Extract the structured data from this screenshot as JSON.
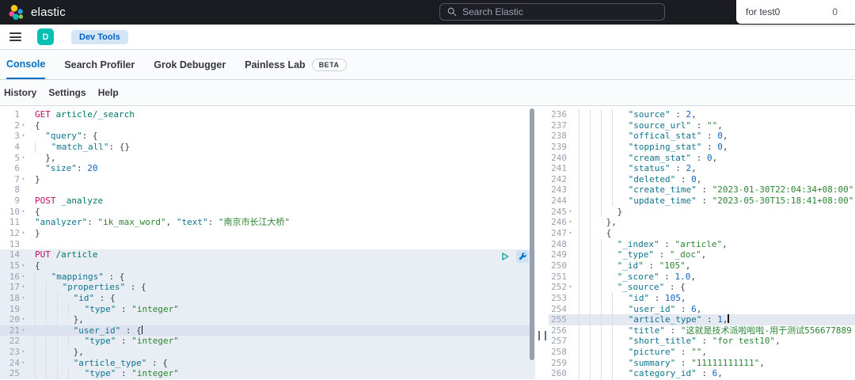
{
  "topbar": {
    "brand": "elastic",
    "search_placeholder": "Search Elastic",
    "popup": {
      "text": "for test0",
      "count": "0"
    }
  },
  "nav": {
    "avatar": "D",
    "breadcrumb": "Dev Tools"
  },
  "tabs": [
    {
      "label": "Console",
      "active": true
    },
    {
      "label": "Search Profiler"
    },
    {
      "label": "Grok Debugger"
    },
    {
      "label": "Painless Lab",
      "beta": "BETA"
    }
  ],
  "menu": {
    "history": "History",
    "settings": "Settings",
    "help": "Help"
  },
  "colors": {
    "topbar_bg": "#1b1c21",
    "accent_blue": "#0071c2",
    "avatar_teal": "#00bfb3",
    "badge_bg": "#d5e5f8",
    "badge_text": "#0061c5",
    "method": "#c80a68",
    "url": "#00756b",
    "key": "#0e7490",
    "string": "#2d8533",
    "number": "#0f62c4",
    "selected_block": "#e9edf4",
    "active_line": "#dce2ee"
  },
  "editor": {
    "left": {
      "lines": [
        {
          "n": 1,
          "seg": [
            [
              "m",
              "GET"
            ],
            [
              "u",
              " article/_search"
            ]
          ]
        },
        {
          "n": 2,
          "f": 1,
          "seg": [
            [
              "p",
              "{"
            ]
          ]
        },
        {
          "n": 3,
          "f": 1,
          "seg": [
            [
              "k",
              "  \"query\""
            ],
            [
              "p",
              ": {"
            ]
          ]
        },
        {
          "n": 4,
          "g": 1,
          "seg": [
            [
              "k",
              " \"match_all\""
            ],
            [
              "p",
              ": {}"
            ]
          ]
        },
        {
          "n": 5,
          "f": 1,
          "seg": [
            [
              "p",
              "  },"
            ]
          ]
        },
        {
          "n": 6,
          "seg": [
            [
              "k",
              "  \"size\""
            ],
            [
              "p",
              ": "
            ],
            [
              "d",
              "20"
            ]
          ]
        },
        {
          "n": 7,
          "f": 1,
          "seg": [
            [
              "p",
              "}"
            ]
          ]
        },
        {
          "n": 8,
          "seg": []
        },
        {
          "n": 9,
          "seg": [
            [
              "m",
              "POST"
            ],
            [
              "u",
              " _analyze"
            ]
          ]
        },
        {
          "n": 10,
          "f": 1,
          "seg": [
            [
              "p",
              "{"
            ]
          ]
        },
        {
          "n": 11,
          "seg": [
            [
              "k",
              "\"analyzer\""
            ],
            [
              "p",
              ": "
            ],
            [
              "s",
              "\"ik_max_word\""
            ],
            [
              "p",
              ", "
            ],
            [
              "k",
              "\"text\""
            ],
            [
              "p",
              ": "
            ],
            [
              "s",
              "\"南京市长江大桥\""
            ]
          ]
        },
        {
          "n": 12,
          "f": 1,
          "seg": [
            [
              "p",
              "}"
            ]
          ]
        },
        {
          "n": 13,
          "seg": []
        },
        {
          "n": 14,
          "hl": "b",
          "seg": [
            [
              "m",
              "PUT"
            ],
            [
              "u",
              " /article"
            ]
          ]
        },
        {
          "n": 15,
          "f": 1,
          "hl": "b",
          "seg": [
            [
              "p",
              "{"
            ]
          ]
        },
        {
          "n": 16,
          "f": 1,
          "hl": "b",
          "g": 1,
          "seg": [
            [
              "k",
              " \"mappings\""
            ],
            [
              "p",
              " : {"
            ]
          ]
        },
        {
          "n": 17,
          "f": 1,
          "hl": "b",
          "g": 2,
          "seg": [
            [
              "k",
              " \"properties\""
            ],
            [
              "p",
              " : {"
            ]
          ]
        },
        {
          "n": 18,
          "f": 1,
          "hl": "b",
          "g": 3,
          "seg": [
            [
              "k",
              " \"id\""
            ],
            [
              "p",
              " : {"
            ]
          ]
        },
        {
          "n": 19,
          "hl": "b",
          "g": 4,
          "seg": [
            [
              "k",
              " \"type\""
            ],
            [
              "p",
              " : "
            ],
            [
              "s",
              "\"integer\""
            ]
          ]
        },
        {
          "n": 20,
          "f": 1,
          "hl": "b",
          "g": 3,
          "seg": [
            [
              "p",
              " },"
            ]
          ]
        },
        {
          "n": 21,
          "f": 1,
          "hl": "bl",
          "g": 3,
          "seg": [
            [
              "k",
              " \"user_id\""
            ],
            [
              "p",
              " : {"
            ],
            [
              "c",
              ""
            ]
          ]
        },
        {
          "n": 22,
          "hl": "b",
          "g": 4,
          "seg": [
            [
              "k",
              " \"type\""
            ],
            [
              "p",
              " : "
            ],
            [
              "s",
              "\"integer\""
            ]
          ]
        },
        {
          "n": 23,
          "f": 1,
          "hl": "b",
          "g": 3,
          "seg": [
            [
              "p",
              " },"
            ]
          ]
        },
        {
          "n": 24,
          "f": 1,
          "hl": "b",
          "g": 3,
          "seg": [
            [
              "k",
              " \"article_type\""
            ],
            [
              "p",
              " : {"
            ]
          ]
        },
        {
          "n": 25,
          "hl": "b",
          "g": 4,
          "seg": [
            [
              "k",
              " \"type\""
            ],
            [
              "p",
              " : "
            ],
            [
              "s",
              "\"integer\""
            ]
          ]
        }
      ]
    },
    "right": {
      "lines": [
        {
          "n": 236,
          "g": 4,
          "seg": [
            [
              "k",
              " \"source\""
            ],
            [
              "p",
              " : "
            ],
            [
              "d",
              "2"
            ],
            [
              "p",
              ","
            ]
          ]
        },
        {
          "n": 237,
          "g": 4,
          "seg": [
            [
              "k",
              " \"source_url\""
            ],
            [
              "p",
              " : "
            ],
            [
              "s",
              "\"\""
            ],
            [
              "p",
              ","
            ]
          ]
        },
        {
          "n": 238,
          "g": 4,
          "seg": [
            [
              "k",
              " \"offical_stat\""
            ],
            [
              "p",
              " : "
            ],
            [
              "d",
              "0"
            ],
            [
              "p",
              ","
            ]
          ]
        },
        {
          "n": 239,
          "g": 4,
          "seg": [
            [
              "k",
              " \"topping_stat\""
            ],
            [
              "p",
              " : "
            ],
            [
              "d",
              "0"
            ],
            [
              "p",
              ","
            ]
          ]
        },
        {
          "n": 240,
          "g": 4,
          "seg": [
            [
              "k",
              " \"cream_stat\""
            ],
            [
              "p",
              " : "
            ],
            [
              "d",
              "0"
            ],
            [
              "p",
              ","
            ]
          ]
        },
        {
          "n": 241,
          "g": 4,
          "seg": [
            [
              "k",
              " \"status\""
            ],
            [
              "p",
              " : "
            ],
            [
              "d",
              "2"
            ],
            [
              "p",
              ","
            ]
          ]
        },
        {
          "n": 242,
          "g": 4,
          "seg": [
            [
              "k",
              " \"deleted\""
            ],
            [
              "p",
              " : "
            ],
            [
              "d",
              "0"
            ],
            [
              "p",
              ","
            ]
          ]
        },
        {
          "n": 243,
          "g": 4,
          "seg": [
            [
              "k",
              " \"create_time\""
            ],
            [
              "p",
              " : "
            ],
            [
              "s",
              "\"2023-01-30T22:04:34+08:00\""
            ],
            [
              "p",
              ","
            ]
          ]
        },
        {
          "n": 244,
          "g": 4,
          "seg": [
            [
              "k",
              " \"update_time\""
            ],
            [
              "p",
              " : "
            ],
            [
              "s",
              "\"2023-05-30T15:18:41+08:00\""
            ]
          ]
        },
        {
          "n": 245,
          "f": 1,
          "g": 3,
          "seg": [
            [
              "p",
              " }"
            ]
          ]
        },
        {
          "n": 246,
          "f": 1,
          "g": 2,
          "seg": [
            [
              "p",
              " },"
            ]
          ]
        },
        {
          "n": 247,
          "f": 1,
          "g": 2,
          "seg": [
            [
              "p",
              " {"
            ]
          ]
        },
        {
          "n": 248,
          "g": 3,
          "seg": [
            [
              "k",
              " \"_index\""
            ],
            [
              "p",
              " : "
            ],
            [
              "s",
              "\"article\""
            ],
            [
              "p",
              ","
            ]
          ]
        },
        {
          "n": 249,
          "g": 3,
          "seg": [
            [
              "k",
              " \"_type\""
            ],
            [
              "p",
              " : "
            ],
            [
              "s",
              "\"_doc\""
            ],
            [
              "p",
              ","
            ]
          ]
        },
        {
          "n": 250,
          "g": 3,
          "seg": [
            [
              "k",
              " \"_id\""
            ],
            [
              "p",
              " : "
            ],
            [
              "s",
              "\"105\""
            ],
            [
              "p",
              ","
            ]
          ]
        },
        {
          "n": 251,
          "g": 3,
          "seg": [
            [
              "k",
              " \"_score\""
            ],
            [
              "p",
              " : "
            ],
            [
              "d",
              "1.0"
            ],
            [
              "p",
              ","
            ]
          ]
        },
        {
          "n": 252,
          "f": 1,
          "g": 3,
          "seg": [
            [
              "k",
              " \"_source\""
            ],
            [
              "p",
              " : {"
            ]
          ]
        },
        {
          "n": 253,
          "g": 4,
          "seg": [
            [
              "k",
              " \"id\""
            ],
            [
              "p",
              " : "
            ],
            [
              "d",
              "105"
            ],
            [
              "p",
              ","
            ]
          ]
        },
        {
          "n": 254,
          "g": 4,
          "seg": [
            [
              "k",
              " \"user_id\""
            ],
            [
              "p",
              " : "
            ],
            [
              "d",
              "6"
            ],
            [
              "p",
              ","
            ]
          ]
        },
        {
          "n": 255,
          "hl": "l",
          "g": 4,
          "seg": [
            [
              "k",
              " \"article_type\""
            ],
            [
              "p",
              " : "
            ],
            [
              "d",
              "1"
            ],
            [
              "p",
              ","
            ],
            [
              "c",
              ""
            ]
          ]
        },
        {
          "n": 256,
          "g": 4,
          "seg": [
            [
              "k",
              " \"title\""
            ],
            [
              "p",
              " : "
            ],
            [
              "s",
              "\"这就是技术派啦啦啦-用于测试556677889"
            ]
          ]
        },
        {
          "n": 257,
          "g": 4,
          "seg": [
            [
              "k",
              " \"short_title\""
            ],
            [
              "p",
              " : "
            ],
            [
              "s",
              "\"for test10\""
            ],
            [
              "p",
              ","
            ]
          ]
        },
        {
          "n": 258,
          "g": 4,
          "seg": [
            [
              "k",
              " \"picture\""
            ],
            [
              "p",
              " : "
            ],
            [
              "s",
              "\"\""
            ],
            [
              "p",
              ","
            ]
          ]
        },
        {
          "n": 259,
          "g": 4,
          "seg": [
            [
              "k",
              " \"summary\""
            ],
            [
              "p",
              " : "
            ],
            [
              "s",
              "\"11111111111\""
            ],
            [
              "p",
              ","
            ]
          ]
        },
        {
          "n": 260,
          "g": 4,
          "seg": [
            [
              "k",
              " \"category_id\""
            ],
            [
              "p",
              " : "
            ],
            [
              "d",
              "6"
            ],
            [
              "p",
              ","
            ]
          ]
        }
      ]
    }
  }
}
